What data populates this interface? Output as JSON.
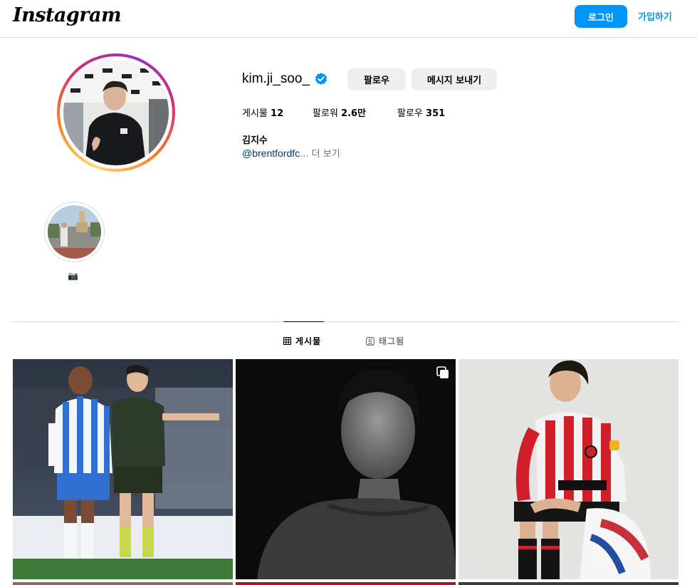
{
  "header": {
    "logo": "Instagram",
    "login_label": "로그인",
    "signup_label": "가입하기"
  },
  "profile": {
    "username": "kim.ji_soo_",
    "verified": true,
    "follow_label": "팔로우",
    "message_label": "메시지 보내기",
    "stats": {
      "posts_label": "게시물",
      "posts_value": "12",
      "followers_label": "팔로워",
      "followers_value": "2.6만",
      "following_label": "팔로우",
      "following_value": "351"
    },
    "full_name": "김지수",
    "bio_mention": "@brentfordfc",
    "bio_more": "... 더 보기"
  },
  "highlights": [
    {
      "label": "📷"
    }
  ],
  "tabs": {
    "posts_label": "게시물",
    "tagged_label": "태그됨"
  },
  "posts": [
    {
      "icon": "none"
    },
    {
      "icon": "multiple-photos-icon"
    },
    {
      "icon": "none"
    }
  ],
  "colors": {
    "accent": "#0095f6",
    "button_bg": "#efefef",
    "border": "#dbdbdb",
    "muted": "#737373"
  }
}
